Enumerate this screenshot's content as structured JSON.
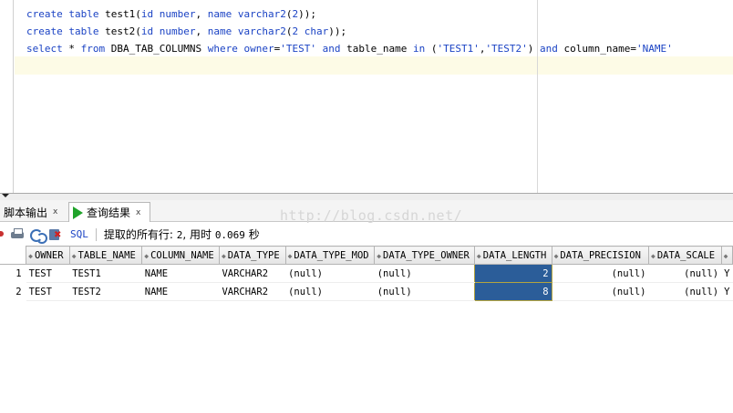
{
  "editor": {
    "lines": [
      [
        {
          "t": "create",
          "k": "kw"
        },
        {
          "t": " ",
          "k": "pl"
        },
        {
          "t": "table",
          "k": "kw"
        },
        {
          "t": " test1(",
          "k": "pl"
        },
        {
          "t": "id",
          "k": "kw"
        },
        {
          "t": " ",
          "k": "pl"
        },
        {
          "t": "number",
          "k": "kw"
        },
        {
          "t": ", ",
          "k": "pl"
        },
        {
          "t": "name",
          "k": "kw"
        },
        {
          "t": " ",
          "k": "pl"
        },
        {
          "t": "varchar2",
          "k": "kw"
        },
        {
          "t": "(",
          "k": "pl"
        },
        {
          "t": "2",
          "k": "kw"
        },
        {
          "t": "));",
          "k": "pl"
        }
      ],
      [
        {
          "t": "create",
          "k": "kw"
        },
        {
          "t": " ",
          "k": "pl"
        },
        {
          "t": "table",
          "k": "kw"
        },
        {
          "t": " test2(",
          "k": "pl"
        },
        {
          "t": "id",
          "k": "kw"
        },
        {
          "t": " ",
          "k": "pl"
        },
        {
          "t": "number",
          "k": "kw"
        },
        {
          "t": ", ",
          "k": "pl"
        },
        {
          "t": "name",
          "k": "kw"
        },
        {
          "t": " ",
          "k": "pl"
        },
        {
          "t": "varchar2",
          "k": "kw"
        },
        {
          "t": "(",
          "k": "pl"
        },
        {
          "t": "2 char",
          "k": "kw"
        },
        {
          "t": "));",
          "k": "pl"
        }
      ],
      [
        {
          "t": "select",
          "k": "kw"
        },
        {
          "t": " * ",
          "k": "pl"
        },
        {
          "t": "from",
          "k": "kw"
        },
        {
          "t": " DBA_TAB_COLUMNS ",
          "k": "pl"
        },
        {
          "t": "where",
          "k": "kw"
        },
        {
          "t": " ",
          "k": "pl"
        },
        {
          "t": "owner",
          "k": "kw"
        },
        {
          "t": "=",
          "k": "pl"
        },
        {
          "t": "'TEST'",
          "k": "str"
        },
        {
          "t": " ",
          "k": "pl"
        },
        {
          "t": "and",
          "k": "kw"
        },
        {
          "t": " table_name ",
          "k": "pl"
        },
        {
          "t": "in",
          "k": "kw"
        },
        {
          "t": " (",
          "k": "pl"
        },
        {
          "t": "'TEST1'",
          "k": "str"
        },
        {
          "t": ",",
          "k": "pl"
        },
        {
          "t": "'TEST2'",
          "k": "str"
        },
        {
          "t": ") ",
          "k": "pl"
        },
        {
          "t": "and",
          "k": "kw"
        },
        {
          "t": " column_name=",
          "k": "pl"
        },
        {
          "t": "'NAME'",
          "k": "str"
        }
      ]
    ]
  },
  "tabs": {
    "script_output": "脚本输出",
    "query_result": "查询结果",
    "close_glyph": "x"
  },
  "watermark": "http://blog.csdn.net/",
  "toolbar": {
    "sql_label": "SQL",
    "status_prefix": "提取的所有行: ",
    "rows": "2",
    "status_mid": ", 用时 ",
    "time": "0.069",
    "status_suffix": " 秒"
  },
  "grid": {
    "columns": [
      "OWNER",
      "TABLE_NAME",
      "COLUMN_NAME",
      "DATA_TYPE",
      "DATA_TYPE_MOD",
      "DATA_TYPE_OWNER",
      "DATA_LENGTH",
      "DATA_PRECISION",
      "DATA_SCALE",
      ""
    ],
    "numeric_columns": [
      6,
      7,
      8
    ],
    "selected_column": 6,
    "rows": [
      {
        "num": "1",
        "cells": [
          "TEST",
          "TEST1",
          "NAME",
          "VARCHAR2",
          "(null)",
          "(null)",
          "2",
          "(null)",
          "(null)",
          "Y"
        ]
      },
      {
        "num": "2",
        "cells": [
          "TEST",
          "TEST2",
          "NAME",
          "VARCHAR2",
          "(null)",
          "(null)",
          "8",
          "(null)",
          "(null)",
          "Y"
        ]
      }
    ]
  },
  "colors": {
    "keyword": "#1b43c4",
    "selection": "#2b5d99",
    "run_icon": "#1fa32a",
    "current_line": "#fdfbe6"
  }
}
